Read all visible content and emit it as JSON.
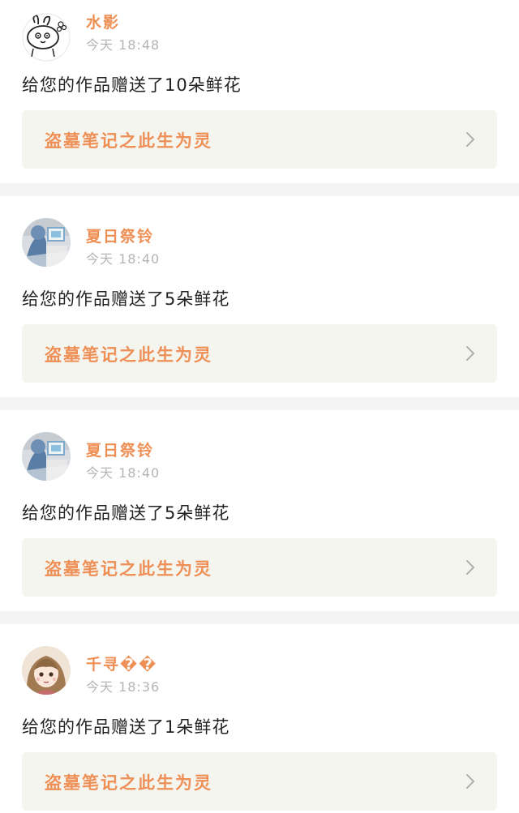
{
  "notifications": [
    {
      "username": "水影",
      "time": "今天 18:48",
      "message": "给您的作品赠送了10朵鲜花",
      "work_title": "盗墓笔记之此生为灵",
      "avatar": "bunny-doodle-avatar"
    },
    {
      "username": "夏日祭铃",
      "time": "今天 18:40",
      "message": "给您的作品赠送了5朵鲜花",
      "work_title": "盗墓笔记之此生为灵",
      "avatar": "photo-avatar-blue"
    },
    {
      "username": "夏日祭铃",
      "time": "今天 18:40",
      "message": "给您的作品赠送了5朵鲜花",
      "work_title": "盗墓笔记之此生为灵",
      "avatar": "photo-avatar-blue"
    },
    {
      "username": "千寻��",
      "time": "今天 18:36",
      "message": "给您的作品赠送了1朵鲜花",
      "work_title": "盗墓笔记之此生为灵",
      "avatar": "anime-girl-avatar"
    }
  ],
  "colors": {
    "accent": "#ee8f55",
    "time": "#b4b4b4",
    "message": "#222222",
    "link_bg": "#f5f5f0",
    "divider": "#f3f3f3"
  },
  "icons": {
    "chevron": "chevron-right-icon"
  }
}
